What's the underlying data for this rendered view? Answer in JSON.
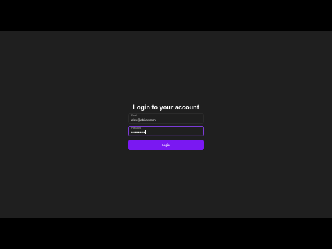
{
  "login": {
    "title": "Login to your account",
    "email": {
      "label": "Email",
      "value": "alex@abilav.com"
    },
    "password": {
      "label": "Password",
      "masked_value": "••••••••••••"
    },
    "button_label": "Login"
  },
  "colors": {
    "background": "#1f1f1f",
    "accent": "#7a18f2",
    "focused_border": "#7b3bd6"
  }
}
